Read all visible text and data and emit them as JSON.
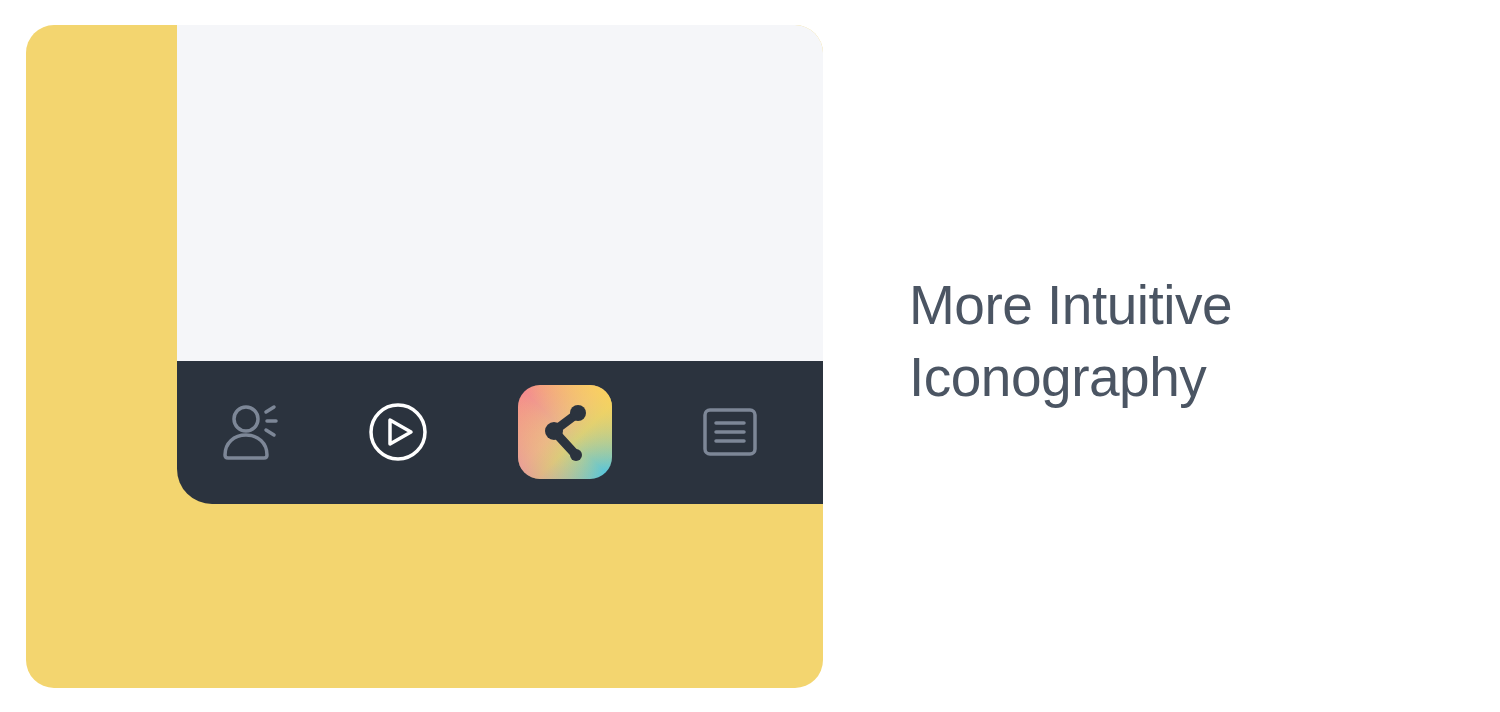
{
  "tab_bar": {
    "items": [
      {
        "kind": "tab",
        "selected": false
      },
      {
        "kind": "tab",
        "selected": true
      },
      {
        "kind": "app",
        "selected": false
      },
      {
        "kind": "tab",
        "selected": false
      }
    ]
  },
  "heading": "More Intuitive Iconography"
}
